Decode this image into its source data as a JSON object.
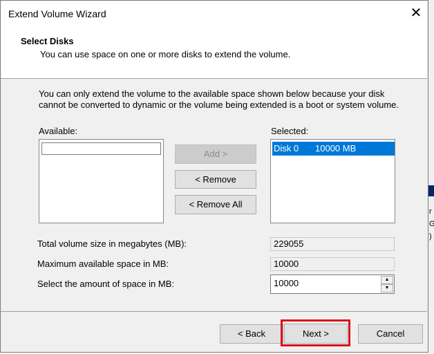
{
  "window": {
    "title": "Extend Volume Wizard",
    "close_glyph": "✕"
  },
  "header": {
    "title": "Select Disks",
    "subtitle": "You can use space on one or more disks to extend the volume."
  },
  "info_text": "You can only extend the volume to the available space shown below because your disk cannot be converted to dynamic or the volume being extended is a boot or system volume.",
  "available": {
    "label": "Available:",
    "items": []
  },
  "selected": {
    "label": "Selected:",
    "items": [
      {
        "disk": "Disk 0",
        "size": "10000 MB"
      }
    ]
  },
  "buttons": {
    "add": "Add >",
    "remove": "< Remove",
    "remove_all": "< Remove All",
    "back": "< Back",
    "next": "Next >",
    "cancel": "Cancel"
  },
  "fields": {
    "total_label": "Total volume size in megabytes (MB):",
    "total_value": "229055",
    "max_label": "Maximum available space in MB:",
    "max_value": "10000",
    "amount_label": "Select the amount of space in MB:",
    "amount_value": "10000"
  },
  "colors": {
    "selection": "#0078d7",
    "highlight_border": "#d9141c"
  },
  "background_fragments": [
    "r",
    "G",
    ")"
  ]
}
